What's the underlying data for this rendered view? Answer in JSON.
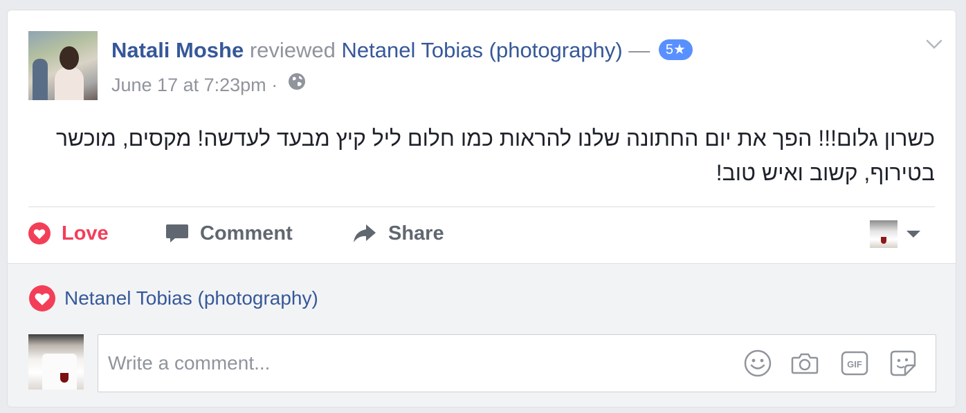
{
  "post": {
    "author": "Natali Moshe",
    "action_text": "reviewed",
    "target_page": "Netanel Tobias (photography)",
    "dash": "—",
    "rating_badge": "5★",
    "timestamp": "June 17 at 7:23pm",
    "separator": "·",
    "privacy_icon": "globe-icon",
    "menu_icon": "chevron-down-icon",
    "text": "כשרון גלום!!! הפך את יום החתונה שלנו להראות כמו חלום ליל קיץ מבעד לעדשה! מקסים, מוכשר בטירוף, קשוב ואיש טוב!"
  },
  "actions": {
    "love_label": "Love",
    "comment_label": "Comment",
    "share_label": "Share"
  },
  "reactions": {
    "reactor": "Netanel Tobias (photography)"
  },
  "comment": {
    "placeholder": "Write a comment...",
    "value": ""
  },
  "colors": {
    "link": "#365899",
    "muted": "#90949c",
    "love": "#f33e58",
    "badge": "#5890ff",
    "footer_bg": "#f2f3f5"
  }
}
